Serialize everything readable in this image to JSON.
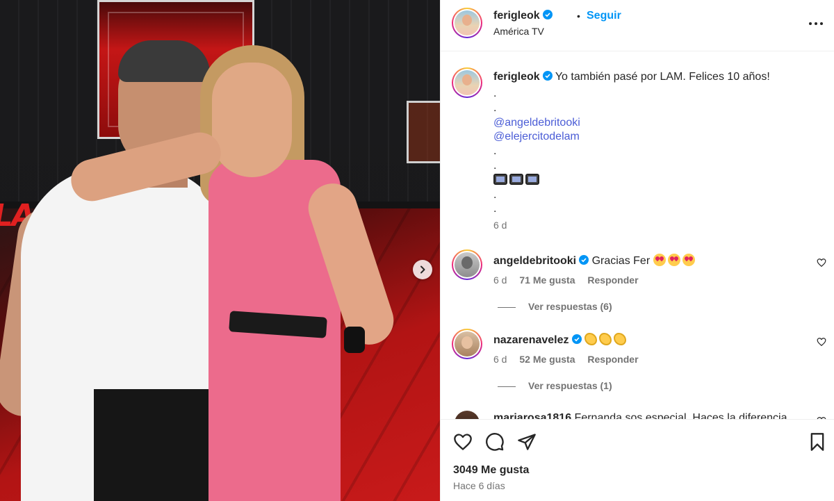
{
  "post": {
    "author": "ferigleok",
    "follow_label": "Seguir",
    "dot": "•",
    "location": "América TV",
    "caption": {
      "username": "ferigleok",
      "text": "Yo también pasé por LAM. Felices 10 años!",
      "lines": [
        ".",
        ".",
        "@angeldebritooki",
        "@elejercitodelam",
        ".",
        ".",
        "",
        ".",
        "."
      ],
      "emoji_line": [
        "tv-icon",
        "tv-icon",
        "tv-icon"
      ],
      "time": "6 d"
    },
    "comments": [
      {
        "username": "angeldebritooki",
        "text": "Gracias Fer",
        "emojis": [
          "heart-eyes",
          "heart-eyes",
          "heart-eyes"
        ],
        "time": "6 d",
        "likes": "71 Me gusta",
        "reply_label": "Responder",
        "replies_label": "Ver respuestas (6)"
      },
      {
        "username": "nazarenavelez",
        "text": "",
        "emojis": [
          "clap",
          "clap",
          "clap"
        ],
        "time": "6 d",
        "likes": "52 Me gusta",
        "reply_label": "Responder",
        "replies_label": "Ver respuestas (1)"
      },
      {
        "username": "mariarosa1816",
        "text": "Fernanda sos especial. Haces la diferencia."
      }
    ],
    "likes_count": "3049 Me gusta",
    "date": "Hace 6 días"
  },
  "colors": {
    "link": "#0095f6",
    "mention": "#4a5cd6",
    "verified": "#0095f6",
    "secondary_text": "#737373"
  }
}
